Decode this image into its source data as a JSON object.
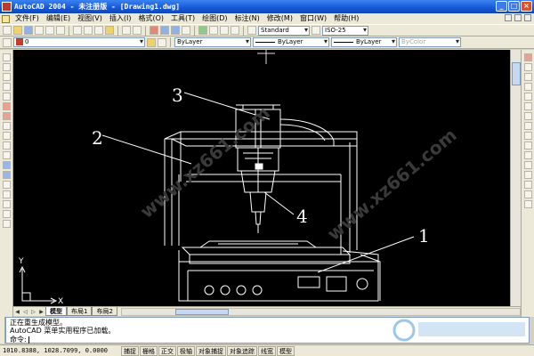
{
  "window": {
    "title": "AutoCAD 2004 - 未注册版 - [Drawing1.dwg]",
    "buttons": [
      "_",
      "□",
      "×"
    ]
  },
  "menu": {
    "items": [
      "文件(F)",
      "编辑(E)",
      "视图(V)",
      "插入(I)",
      "格式(O)",
      "工具(T)",
      "绘图(D)",
      "标注(N)",
      "修改(M)",
      "窗口(W)",
      "帮助(H)"
    ]
  },
  "toolbar": {
    "text_style": "Standard",
    "dim_style": "ISO-25"
  },
  "layer": {
    "current": "0"
  },
  "properties": {
    "color": "ByLayer",
    "linetype": "ByLayer",
    "lineweight": "ByLayer",
    "plot_style": "ByColor"
  },
  "drawing": {
    "callouts": [
      "1",
      "2",
      "3",
      "4"
    ],
    "ucs_y": "Y",
    "ucs_x": "X",
    "watermark": "www.xz661.com"
  },
  "layout_tabs": [
    "模型",
    "布局1",
    "布局2"
  ],
  "command": {
    "lines": [
      "正在重生成模型。",
      "AutoCAD 菜单实用程序已加载。"
    ],
    "prompt": "命令:"
  },
  "status": {
    "coordinates": "1010.8388, 1028.7099, 0.0000",
    "toggles": [
      "捕捉",
      "栅格",
      "正交",
      "极轴",
      "对象捕捉",
      "对象追踪",
      "线宽",
      "模型"
    ]
  },
  "colors": {
    "canvas": "#000000",
    "titlebar": "#1558d6",
    "chrome": "#ece9d8"
  }
}
